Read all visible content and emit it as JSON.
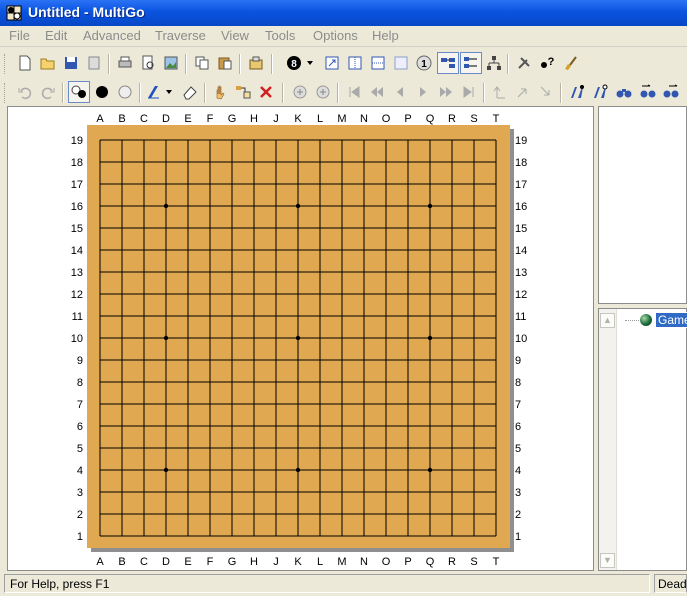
{
  "window": {
    "title": "Untitled - MultiGo"
  },
  "menu": [
    {
      "label": "File"
    },
    {
      "label": "Edit"
    },
    {
      "label": "Advanced"
    },
    {
      "label": "Traverse"
    },
    {
      "label": "View"
    },
    {
      "label": "Tools"
    },
    {
      "label": "Options"
    },
    {
      "label": "Help"
    }
  ],
  "toolbar1": [
    {
      "name": "new-file-icon"
    },
    {
      "name": "open-folder-icon"
    },
    {
      "name": "save-icon"
    },
    {
      "name": "save-as-icon"
    },
    {
      "name": "print-icon"
    },
    {
      "name": "print-preview-icon"
    },
    {
      "name": "export-image-icon"
    },
    {
      "name": "copy-icon"
    },
    {
      "name": "paste-icon"
    },
    {
      "name": "game-info-icon"
    },
    {
      "name": "move-number-icon",
      "text": "8"
    },
    {
      "name": "dropdown-arrow-icon"
    },
    {
      "name": "goto-move-icon"
    },
    {
      "name": "vertical-split-icon"
    },
    {
      "name": "horizontal-split-icon"
    },
    {
      "name": "blank-panel-icon"
    },
    {
      "name": "show-number-icon",
      "text": "1"
    },
    {
      "name": "tree-view-icon"
    },
    {
      "name": "tree-view-alt-icon"
    },
    {
      "name": "tree-structure-icon"
    },
    {
      "name": "tools-icon"
    },
    {
      "name": "help-context-icon"
    },
    {
      "name": "brush-icon"
    }
  ],
  "toolbar2": [
    {
      "name": "undo-icon"
    },
    {
      "name": "redo-icon"
    },
    {
      "name": "alternate-stones-icon"
    },
    {
      "name": "black-stone-icon"
    },
    {
      "name": "white-stone-icon"
    },
    {
      "name": "markup-icon"
    },
    {
      "name": "dropdown-arrow-icon"
    },
    {
      "name": "eraser-icon"
    },
    {
      "name": "hand-icon"
    },
    {
      "name": "setup-icon"
    },
    {
      "name": "delete-icon"
    },
    {
      "name": "pass-icon"
    },
    {
      "name": "pass-alt-icon"
    },
    {
      "name": "first-move-icon"
    },
    {
      "name": "fast-back-icon"
    },
    {
      "name": "back-icon"
    },
    {
      "name": "forward-icon"
    },
    {
      "name": "fast-forward-icon"
    },
    {
      "name": "last-move-icon"
    },
    {
      "name": "branch-up-icon"
    },
    {
      "name": "branch-prev-icon"
    },
    {
      "name": "branch-next-icon"
    },
    {
      "name": "find-icon"
    },
    {
      "name": "find-next-icon"
    },
    {
      "name": "find-all-icon"
    },
    {
      "name": "find-prev-icon"
    },
    {
      "name": "find-last-icon"
    }
  ],
  "board": {
    "size": 19,
    "columns": [
      "A",
      "B",
      "C",
      "D",
      "E",
      "F",
      "G",
      "H",
      "J",
      "K",
      "L",
      "M",
      "N",
      "O",
      "P",
      "Q",
      "R",
      "S",
      "T"
    ],
    "rows": [
      "19",
      "18",
      "17",
      "16",
      "15",
      "14",
      "13",
      "12",
      "11",
      "10",
      "9",
      "8",
      "7",
      "6",
      "5",
      "4",
      "3",
      "2",
      "1"
    ],
    "star_points": [
      "D16",
      "K16",
      "Q16",
      "D10",
      "K10",
      "Q10",
      "D4",
      "K4",
      "Q4"
    ],
    "colors": {
      "wood": "#e0a850",
      "grid": "#000000",
      "shadow": "#8f8f8f"
    }
  },
  "tree": {
    "root_label": "Game"
  },
  "status": {
    "help_text": "For Help, press F1",
    "right_text": "Dead"
  }
}
